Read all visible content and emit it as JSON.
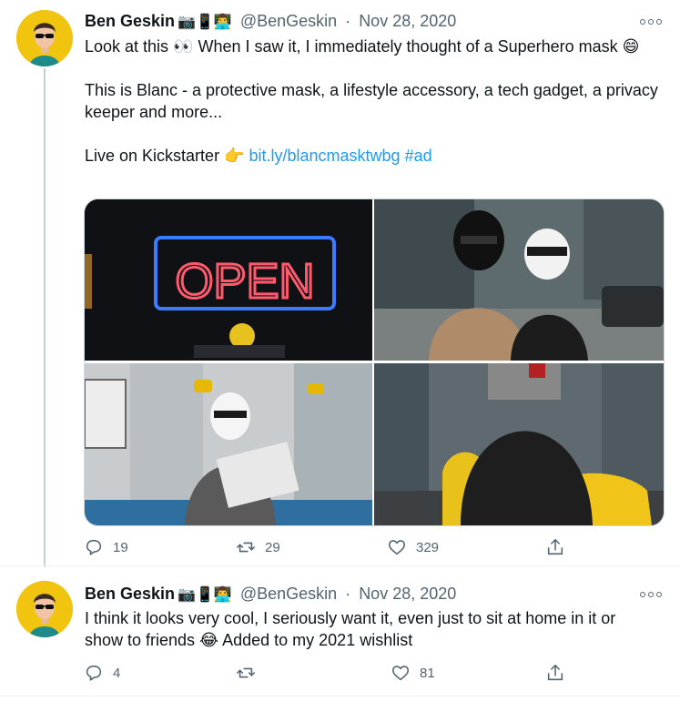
{
  "tweets": [
    {
      "author_name": "Ben Geskin",
      "emojis": "📷📱👨‍💻",
      "handle": "@BenGeskin",
      "separator": "·",
      "date": "Nov 28, 2020",
      "text_line1": "Look at this 👀 When I saw it, I immediately thought of a Superhero mask 😄",
      "text_line2": "This is Blanc - a protective mask, a lifestyle accessory, a tech gadget, a privacy keeper and more...",
      "text_line3_prefix": "Live on Kickstarter 👉 ",
      "link": "bit.ly/blancmasktwbg",
      "hashtag": "#ad",
      "media": [
        {
          "sign_text": "OPEN",
          "sign_color": "#ff5a6e",
          "frame_color": "#3a7bff"
        },
        {
          "label": "two people in masks on street"
        },
        {
          "label": "person reading newspaper on train"
        },
        {
          "label": "person walking near yellow car"
        }
      ],
      "replies": "19",
      "retweets": "29",
      "likes": "329"
    },
    {
      "author_name": "Ben Geskin",
      "emojis": "📷📱👨‍💻",
      "handle": "@BenGeskin",
      "separator": "·",
      "date": "Nov 28, 2020",
      "text": "I think it looks very cool, I seriously want it, even just to sit at home in it or show to friends 😂 Added to my 2021 wishlist",
      "replies": "4",
      "retweets": "",
      "likes": "81"
    }
  ],
  "colors": {
    "accent": "#1d9bf0",
    "muted": "#536471",
    "text": "#0f1419",
    "avatar_bg": "#f1c40f"
  }
}
